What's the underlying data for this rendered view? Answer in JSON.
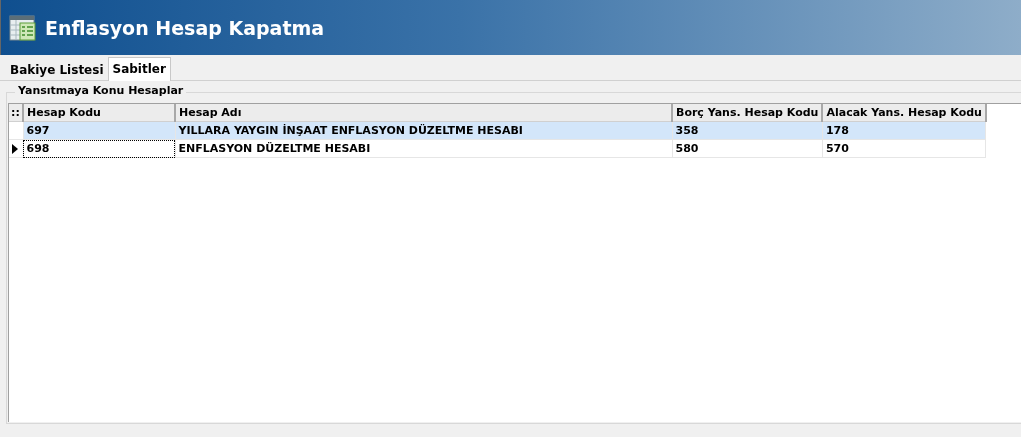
{
  "window": {
    "title": "Enflasyon Hesap Kapatma"
  },
  "tabs": [
    {
      "label": "Bakiye Listesi",
      "selected": false
    },
    {
      "label": "Sabitler",
      "selected": true
    }
  ],
  "group": {
    "title": "Yansıtmaya Konu Hesaplar"
  },
  "table": {
    "indicator_header": "::",
    "columns": [
      "Hesap Kodu",
      "Hesap Adı",
      "Borç Yans. Hesap Kodu",
      "Alacak Yans. Hesap Kodu"
    ],
    "rows": [
      {
        "cells": [
          "697",
          "YILLARA YAYGIN İNŞAAT ENFLASYON DÜZELTME HESABI",
          "358",
          "178"
        ],
        "selected": true,
        "current": false
      },
      {
        "cells": [
          "698",
          "ENFLASYON DÜZELTME HESABI",
          "580",
          "570"
        ],
        "selected": false,
        "current": true
      }
    ]
  }
}
